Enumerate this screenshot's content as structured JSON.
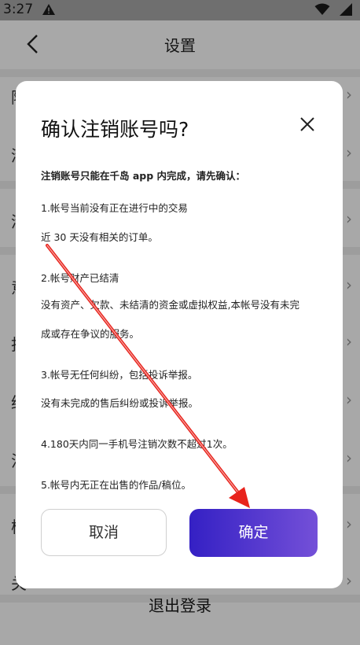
{
  "status_bar": {
    "time": "3:27"
  },
  "header": {
    "title": "设置",
    "back": "back-icon"
  },
  "background_rows": [
    {
      "glyph": "隐"
    },
    {
      "glyph": "清"
    },
    {
      "glyph": "清"
    },
    {
      "glyph": "意"
    },
    {
      "glyph": "投"
    },
    {
      "glyph": "给"
    },
    {
      "glyph": "注"
    },
    {
      "glyph": "检"
    },
    {
      "glyph": "关"
    }
  ],
  "logout": "退出登录",
  "dialog": {
    "title": "确认注销账号吗?",
    "intro": "注销账号只能在千岛 app 内完成，请先确认：",
    "lines": [
      "1.帐号当前没有正在进行中的交易",
      "近 30 天没有相关的订单。",
      "2.帐号财产已结清",
      "没有资产、欠款、未结清的资金或虚拟权益,本帐号没有未完",
      "成或存在争议的服务。",
      "3.帐号无任何纠纷，包括投诉举报。",
      "没有未完成的售后纠纷或投诉举报。",
      "4.180天内同一手机号注销次数不超过1次。",
      "5.帐号内无正在出售的作品/稿位。"
    ],
    "cancel_label": "取消",
    "confirm_label": "确定"
  },
  "colors": {
    "confirm_gradient_start": "#3420c4",
    "confirm_gradient_end": "#7450d8",
    "annotation_arrow": "#e8231c"
  }
}
